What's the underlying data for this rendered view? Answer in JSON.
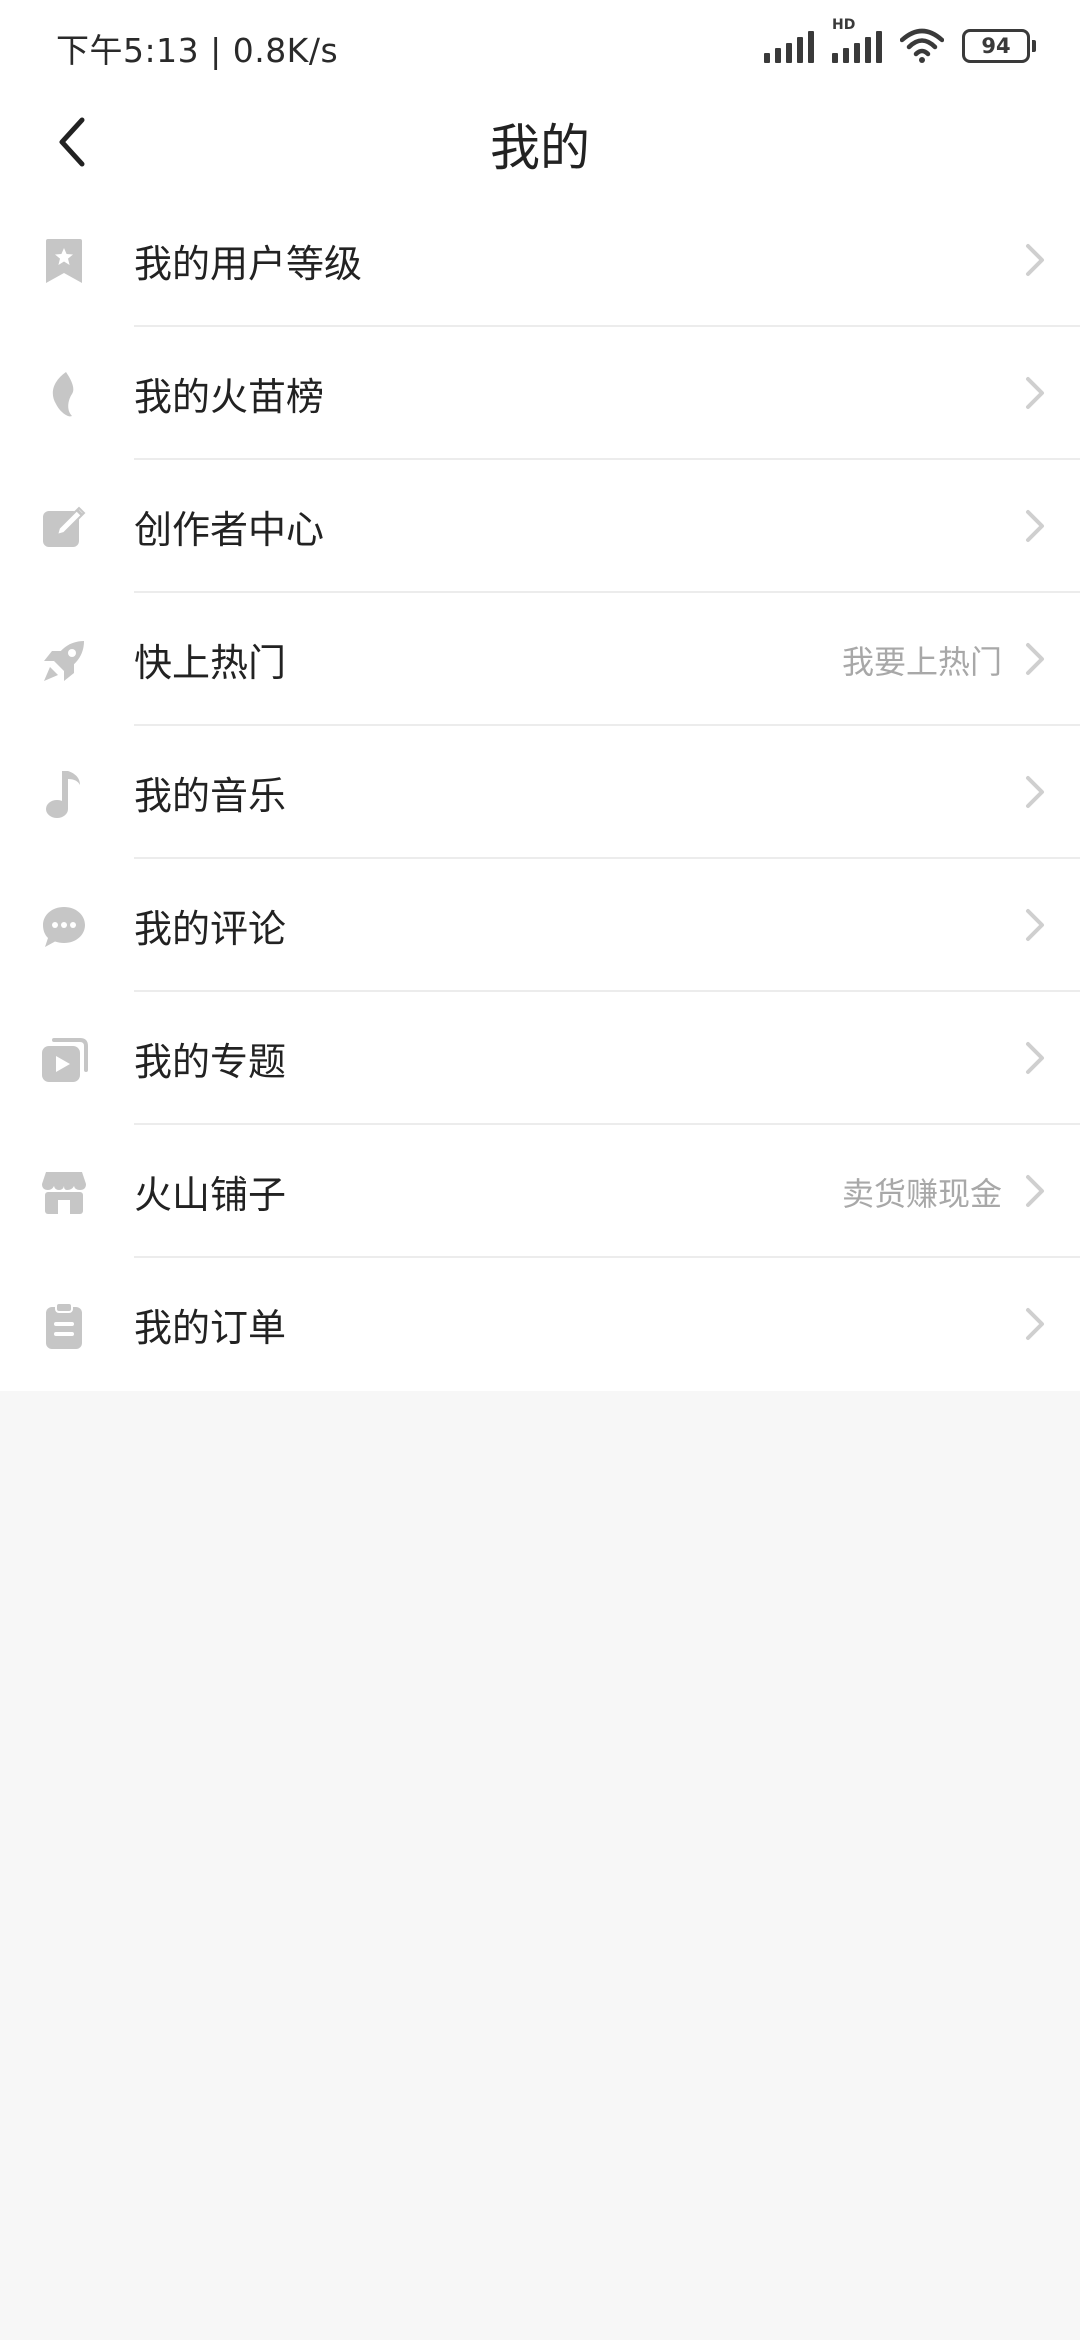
{
  "status": {
    "time_net": "下午5:13 | 0.8K/s",
    "hd": "HD",
    "battery": "94",
    "icons": [
      "signal-icon",
      "hd-signal-icon",
      "wifi-icon",
      "battery-icon"
    ]
  },
  "header": {
    "title": "我的",
    "back_icon": "back-arrow-icon"
  },
  "menu": {
    "items": [
      {
        "label": "我的用户等级",
        "hint": "",
        "icon": "bookmark-star-icon"
      },
      {
        "label": "我的火苗榜",
        "hint": "",
        "icon": "flame-icon"
      },
      {
        "label": "创作者中心",
        "hint": "",
        "icon": "edit-icon"
      },
      {
        "label": "快上热门",
        "hint": "我要上热门",
        "icon": "rocket-icon"
      },
      {
        "label": "我的音乐",
        "hint": "",
        "icon": "music-note-icon"
      },
      {
        "label": "我的评论",
        "hint": "",
        "icon": "comment-icon"
      },
      {
        "label": "我的专题",
        "hint": "",
        "icon": "playlist-icon"
      },
      {
        "label": "火山铺子",
        "hint": "卖货赚现金",
        "icon": "shop-icon"
      },
      {
        "label": "我的订单",
        "hint": "",
        "icon": "clipboard-icon"
      }
    ]
  },
  "colors": {
    "icon_gray": "#c6c6c6",
    "text": "#222222",
    "hint": "#a8a8a8",
    "background": "#f7f7f7"
  }
}
